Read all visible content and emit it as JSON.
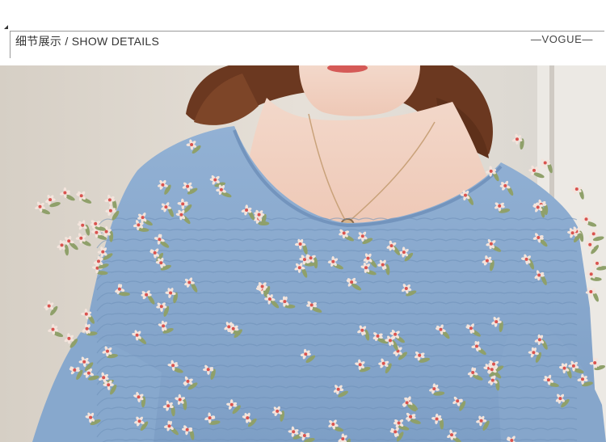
{
  "header": {
    "title_cn": "细节展示",
    "separator": " / ",
    "title_en": "SHOW DETAILS",
    "brand": "—VOGUE—"
  },
  "photo": {
    "subject": "floral-blouse-detail-photo"
  },
  "colors": {
    "fabric_blue": "#88a9cf",
    "flower_red": "#d9534f",
    "leaf_green": "#8fa06a",
    "hair_brown": "#6e3a22",
    "skin": "#f1d2c2"
  }
}
